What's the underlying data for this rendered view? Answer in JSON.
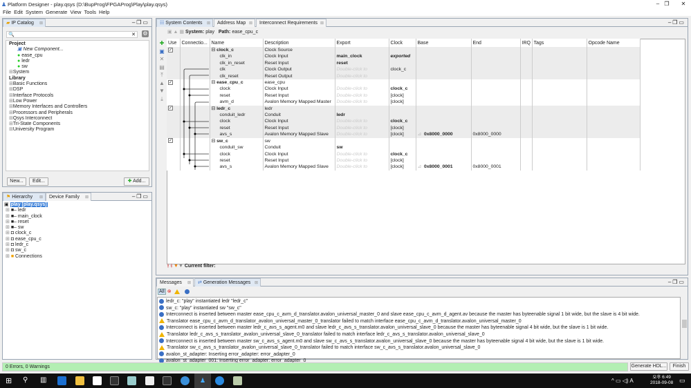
{
  "window": {
    "title": "Platform Designer - play.qsys (D:\\BupProg\\FPGAProg\\Play\\play.qsys)"
  },
  "menu": [
    "File",
    "Edit",
    "System",
    "Generate",
    "View",
    "Tools",
    "Help"
  ],
  "ip_catalog": {
    "tab": "IP Catalog",
    "search_placeholder": "",
    "project_label": "Project",
    "project_items": [
      "New Component...",
      "ease_cpu",
      "ledr",
      "sw"
    ],
    "system_item": "System",
    "library_label": "Library",
    "library_items": [
      "Basic Functions",
      "DSP",
      "Interface Protocols",
      "Low Power",
      "Memory Interfaces and Controllers",
      "Processors and Peripherals",
      "Qsys Interconnect",
      "Tri-State Components",
      "University Program"
    ],
    "new_btn": "New...",
    "edit_btn": "Edit...",
    "add_btn": "Add..."
  },
  "hierarchy": {
    "tabs": [
      "Hierarchy",
      "Device Family"
    ],
    "root": "play [play.qsys]",
    "items": [
      "ledr",
      "main_clock",
      "reset",
      "sw",
      "clock_c",
      "ease_cpu_c",
      "ledr_c",
      "sw_c",
      "Connections"
    ]
  },
  "system_contents": {
    "tabs": [
      "System Contents",
      "Address Map",
      "Interconnect Requirements"
    ],
    "system_label": "System:",
    "system_value": "play",
    "path_label": "Path:",
    "path_value": "ease_cpu_c",
    "columns": [
      "Use",
      "Connectio...",
      "Name",
      "Description",
      "Export",
      "Clock",
      "Base",
      "End",
      "IRQ",
      "Tags",
      "Opcode Name"
    ],
    "rows": [
      {
        "g": 0,
        "use": true,
        "name": "clock_c",
        "head": true,
        "desc": "Clock Source",
        "export": "",
        "clock": "",
        "base": "",
        "end": ""
      },
      {
        "g": 0,
        "name": "clk_in",
        "desc": "Clock Input",
        "export": "main_clock",
        "ex": "b",
        "clock": "exported",
        "ck": "bi"
      },
      {
        "g": 0,
        "name": "clk_in_reset",
        "desc": "Reset Input",
        "export": "reset",
        "ex": "b",
        "clock": ""
      },
      {
        "g": 0,
        "name": "clk",
        "desc": "Clock Output",
        "export": "Double-click to",
        "ex": "dim",
        "clock": "clock_c"
      },
      {
        "g": 0,
        "name": "clk_reset",
        "desc": "Reset Output",
        "export": "Double-click to",
        "ex": "dim",
        "clock": ""
      },
      {
        "g": 1,
        "use": true,
        "name": "ease_cpu_c",
        "head": true,
        "desc": "ease_cpu",
        "export": "",
        "clock": ""
      },
      {
        "g": 1,
        "name": "clock",
        "desc": "Clock Input",
        "export": "Double-click to",
        "ex": "dim",
        "clock": "clock_c",
        "ck": "b"
      },
      {
        "g": 1,
        "name": "reset",
        "desc": "Reset Input",
        "export": "Double-click to",
        "ex": "dim",
        "clock": "[clock]"
      },
      {
        "g": 1,
        "name": "avm_d",
        "desc": "Avalon Memory Mapped Master",
        "export": "Double-click to",
        "ex": "dim",
        "clock": "[clock]"
      },
      {
        "g": 0,
        "use": true,
        "name": "ledr_c",
        "head": true,
        "desc": "ledr",
        "export": "",
        "clock": ""
      },
      {
        "g": 0,
        "name": "conduit_ledr",
        "desc": "Conduit",
        "export": "ledr",
        "ex": "b",
        "clock": ""
      },
      {
        "g": 0,
        "name": "clock",
        "desc": "Clock Input",
        "export": "Double-click to",
        "ex": "dim",
        "clock": "clock_c",
        "ck": "b"
      },
      {
        "g": 0,
        "name": "reset",
        "desc": "Reset Input",
        "export": "Double-click to",
        "ex": "dim",
        "clock": "[clock]"
      },
      {
        "g": 0,
        "name": "avs_s",
        "desc": "Avalon Memory Mapped Slave",
        "export": "Double-click to",
        "ex": "dim",
        "clock": "[clock]",
        "base": "0x8000_0000",
        "end": "0x8000_0000"
      },
      {
        "g": 1,
        "use": true,
        "name": "sw_c",
        "head": true,
        "desc": "sw",
        "export": "",
        "clock": ""
      },
      {
        "g": 1,
        "name": "conduit_sw",
        "desc": "Conduit",
        "export": "sw",
        "ex": "b",
        "clock": ""
      },
      {
        "g": 1,
        "name": "clock",
        "desc": "Clock Input",
        "export": "Double-click to",
        "ex": "dim",
        "clock": "clock_c",
        "ck": "b"
      },
      {
        "g": 1,
        "name": "reset",
        "desc": "Reset Input",
        "export": "Double-click to",
        "ex": "dim",
        "clock": "[clock]"
      },
      {
        "g": 1,
        "name": "avs_s",
        "desc": "Avalon Memory Mapped Slave",
        "export": "Double-click to",
        "ex": "dim",
        "clock": "[clock]",
        "base": "0x8000_0001",
        "end": "0x8000_0001"
      }
    ],
    "filter_label": "Current filter:"
  },
  "messages": {
    "tabs": [
      "Messages",
      "Generation Messages"
    ],
    "all_btn": "All",
    "lines": [
      {
        "type": "info",
        "text": "ledr_c: \"play\" instantiated ledr \"ledr_c\""
      },
      {
        "type": "info",
        "text": "sw_c: \"play\" instantiated sw \"sw_c\""
      },
      {
        "type": "info",
        "text": "Interconnect is inserted between master ease_cpu_c_avm_d_translator.avalon_universal_master_0 and slave ease_cpu_c_avm_d_agent.av because the master has byteenable signal 1 bit wide, but the slave is 4 bit wide."
      },
      {
        "type": "warn",
        "text": "Translator ease_cpu_c_avm_d_translator_avalon_universal_master_0_translator failed to match interface ease_cpu_c_avm_d_translator.avalon_universal_master_0"
      },
      {
        "type": "info",
        "text": "Interconnect is inserted between master ledr_c_avs_s_agent.m0 and slave ledr_c_avs_s_translator.avalon_universal_slave_0 because the master has byteenable signal 4 bit wide, but the slave is 1 bit wide."
      },
      {
        "type": "warn",
        "text": "Translator ledr_c_avs_s_translator_avalon_universal_slave_0_translator failed to match interface ledr_c_avs_s_translator.avalon_universal_slave_0"
      },
      {
        "type": "info",
        "text": "Interconnect is inserted between master sw_c_avs_s_agent.m0 and slave sw_c_avs_s_translator.avalon_universal_slave_0 because the master has byteenable signal 4 bit wide, but the slave is 1 bit wide."
      },
      {
        "type": "warn",
        "text": "Translator sw_c_avs_s_translator_avalon_universal_slave_0_translator failed to match interface sw_c_avs_s_translator.avalon_universal_slave_0"
      },
      {
        "type": "info",
        "text": "avalon_st_adapter: Inserting error_adapter: error_adapter_0"
      },
      {
        "type": "info",
        "text": "avalon_st_adapter_001: Inserting error_adapter: error_adapter_0"
      }
    ]
  },
  "status": {
    "text": "0 Errors, 0 Warnings",
    "generate_btn": "Generate HDL...",
    "finish_btn": "Finish",
    "color": "#b3efb3"
  },
  "taskbar": {
    "time": "오후 6:49",
    "date": "2018-09-08",
    "ime": "A"
  }
}
